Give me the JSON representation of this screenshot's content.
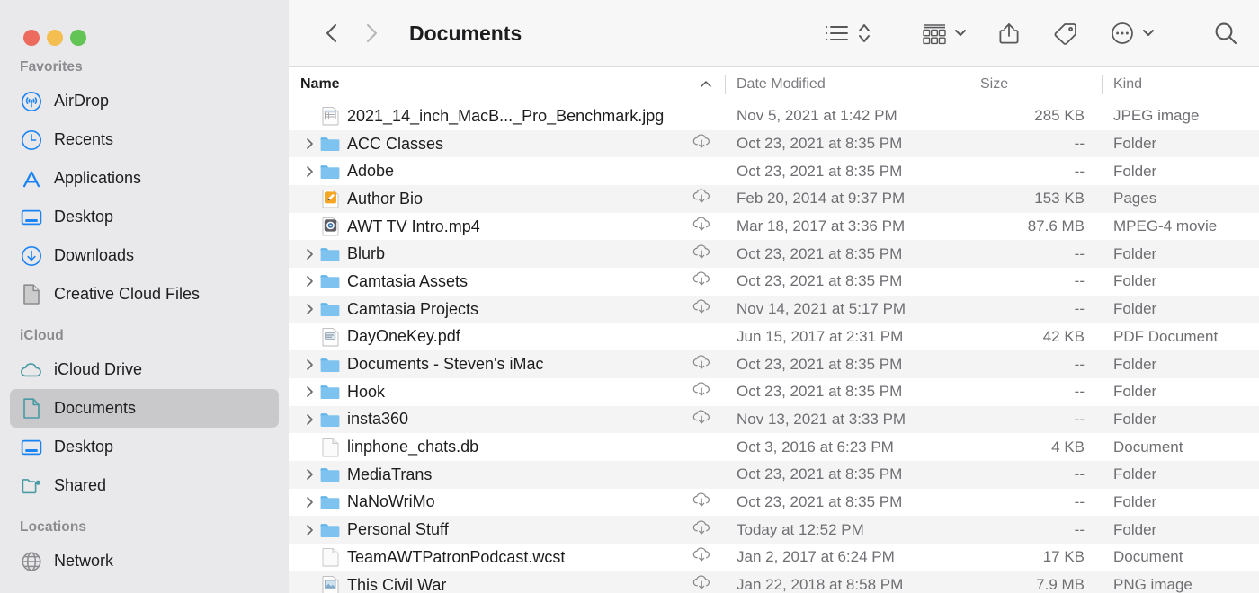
{
  "window": {
    "traffic_lights": [
      {
        "name": "close",
        "color": "#ed6a5e"
      },
      {
        "name": "minimize",
        "color": "#f4bf50"
      },
      {
        "name": "maximize",
        "color": "#61c454"
      }
    ]
  },
  "sidebar": {
    "sections": [
      {
        "title": "Favorites",
        "items": [
          {
            "label": "AirDrop",
            "icon": "airdrop-icon",
            "selected": false
          },
          {
            "label": "Recents",
            "icon": "clock-icon",
            "selected": false
          },
          {
            "label": "Applications",
            "icon": "applications-icon",
            "selected": false
          },
          {
            "label": "Desktop",
            "icon": "desktop-icon",
            "selected": false
          },
          {
            "label": "Downloads",
            "icon": "downloads-icon",
            "selected": false
          },
          {
            "label": "Creative Cloud Files",
            "icon": "document-icon",
            "selected": false
          }
        ]
      },
      {
        "title": "iCloud",
        "items": [
          {
            "label": "iCloud Drive",
            "icon": "cloud-icon",
            "selected": false
          },
          {
            "label": "Documents",
            "icon": "document-icon",
            "selected": true
          },
          {
            "label": "Desktop",
            "icon": "desktop-icon",
            "selected": false
          },
          {
            "label": "Shared",
            "icon": "shared-folder-icon",
            "selected": false
          }
        ]
      },
      {
        "title": "Locations",
        "items": [
          {
            "label": "Network",
            "icon": "globe-icon",
            "selected": false
          }
        ]
      }
    ]
  },
  "toolbar": {
    "back_label": "Back",
    "forward_label": "Forward",
    "title": "Documents",
    "buttons": [
      {
        "name": "list-view-icon",
        "label": "List View"
      },
      {
        "name": "sort-stepper-icon",
        "label": "Sort"
      },
      {
        "name": "group-view-icon",
        "label": "Group By"
      },
      {
        "name": "share-icon",
        "label": "Share"
      },
      {
        "name": "tag-icon",
        "label": "Tags"
      },
      {
        "name": "more-actions-icon",
        "label": "More"
      },
      {
        "name": "search-icon",
        "label": "Search"
      }
    ]
  },
  "columns": {
    "headers": [
      {
        "label": "Name",
        "sorted": true,
        "sort_direction": "asc"
      },
      {
        "label": "Date Modified",
        "sorted": false
      },
      {
        "label": "Size",
        "sorted": false
      },
      {
        "label": "Kind",
        "sorted": false
      }
    ]
  },
  "files": [
    {
      "name": "2021_14_inch_MacB..._Pro_Benchmark.jpg",
      "icon": "jpeg-file-icon",
      "expandable": false,
      "cloud": false,
      "date": "Nov 5, 2021 at 1:42 PM",
      "size": "285 KB",
      "kind": "JPEG image"
    },
    {
      "name": "ACC Classes",
      "icon": "folder-icon",
      "expandable": true,
      "cloud": true,
      "date": "Oct 23, 2021 at 8:35 PM",
      "size": "--",
      "kind": "Folder"
    },
    {
      "name": "Adobe",
      "icon": "folder-icon",
      "expandable": true,
      "cloud": false,
      "date": "Oct 23, 2021 at 8:35 PM",
      "size": "--",
      "kind": "Folder"
    },
    {
      "name": "Author Bio",
      "icon": "pages-file-icon",
      "expandable": false,
      "cloud": true,
      "date": "Feb 20, 2014 at 9:37 PM",
      "size": "153 KB",
      "kind": "Pages"
    },
    {
      "name": "AWT TV Intro.mp4",
      "icon": "movie-file-icon",
      "expandable": false,
      "cloud": true,
      "date": "Mar 18, 2017 at 3:36 PM",
      "size": "87.6 MB",
      "kind": "MPEG-4 movie"
    },
    {
      "name": "Blurb",
      "icon": "folder-icon",
      "expandable": true,
      "cloud": true,
      "date": "Oct 23, 2021 at 8:35 PM",
      "size": "--",
      "kind": "Folder"
    },
    {
      "name": "Camtasia Assets",
      "icon": "folder-icon",
      "expandable": true,
      "cloud": true,
      "date": "Oct 23, 2021 at 8:35 PM",
      "size": "--",
      "kind": "Folder"
    },
    {
      "name": "Camtasia Projects",
      "icon": "folder-icon",
      "expandable": true,
      "cloud": true,
      "date": "Nov 14, 2021 at 5:17 PM",
      "size": "--",
      "kind": "Folder"
    },
    {
      "name": "DayOneKey.pdf",
      "icon": "pdf-file-icon",
      "expandable": false,
      "cloud": false,
      "date": "Jun 15, 2017 at 2:31 PM",
      "size": "42 KB",
      "kind": "PDF Document"
    },
    {
      "name": "Documents - Steven's iMac",
      "icon": "folder-icon",
      "expandable": true,
      "cloud": true,
      "date": "Oct 23, 2021 at 8:35 PM",
      "size": "--",
      "kind": "Folder"
    },
    {
      "name": "Hook",
      "icon": "folder-icon",
      "expandable": true,
      "cloud": true,
      "date": "Oct 23, 2021 at 8:35 PM",
      "size": "--",
      "kind": "Folder"
    },
    {
      "name": "insta360",
      "icon": "folder-icon",
      "expandable": true,
      "cloud": true,
      "date": "Nov 13, 2021 at 3:33 PM",
      "size": "--",
      "kind": "Folder"
    },
    {
      "name": "linphone_chats.db",
      "icon": "generic-file-icon",
      "expandable": false,
      "cloud": false,
      "date": "Oct 3, 2016 at 6:23 PM",
      "size": "4 KB",
      "kind": "Document"
    },
    {
      "name": "MediaTrans",
      "icon": "folder-icon",
      "expandable": true,
      "cloud": false,
      "date": "Oct 23, 2021 at 8:35 PM",
      "size": "--",
      "kind": "Folder"
    },
    {
      "name": "NaNoWriMo",
      "icon": "folder-icon",
      "expandable": true,
      "cloud": true,
      "date": "Oct 23, 2021 at 8:35 PM",
      "size": "--",
      "kind": "Folder"
    },
    {
      "name": "Personal Stuff",
      "icon": "folder-icon",
      "expandable": true,
      "cloud": true,
      "date": "Today at 12:52 PM",
      "size": "--",
      "kind": "Folder"
    },
    {
      "name": "TeamAWTPatronPodcast.wcst",
      "icon": "generic-file-icon",
      "expandable": false,
      "cloud": true,
      "date": "Jan 2, 2017 at 6:24 PM",
      "size": "17 KB",
      "kind": "Document"
    },
    {
      "name": "This Civil War",
      "icon": "png-file-icon",
      "expandable": false,
      "cloud": true,
      "date": "Jan 22, 2018 at 8:58 PM",
      "size": "7.9 MB",
      "kind": "PNG image"
    }
  ]
}
